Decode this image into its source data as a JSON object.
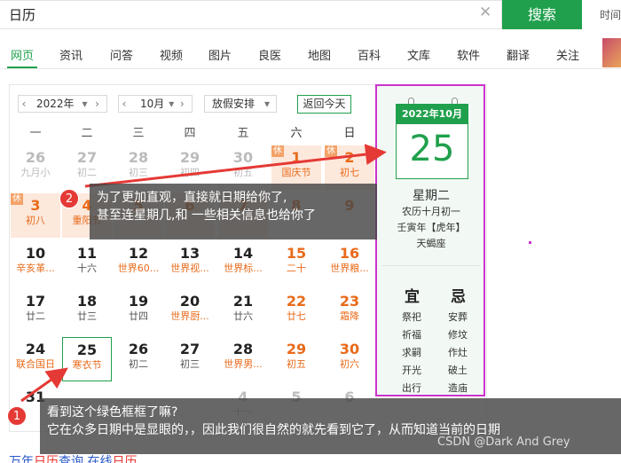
{
  "search": {
    "query": "日历",
    "button": "搜索",
    "time_link": "时间"
  },
  "tabs": [
    "网页",
    "资讯",
    "问答",
    "视频",
    "图片",
    "良医",
    "地图",
    "百科",
    "文库",
    "软件",
    "翻译",
    "关注"
  ],
  "controls": {
    "year": "2022年",
    "month": "10月",
    "holiday": "放假安排",
    "today": "返回今天"
  },
  "weekdays": [
    "一",
    "二",
    "三",
    "四",
    "五",
    "六",
    "日"
  ],
  "rows": [
    [
      {
        "n": "26",
        "l": "九月小",
        "o": true
      },
      {
        "n": "27",
        "l": "初二",
        "o": true
      },
      {
        "n": "28",
        "l": "初三",
        "o": true
      },
      {
        "n": "29",
        "l": "初四",
        "o": true
      },
      {
        "n": "30",
        "l": "初五",
        "o": true
      },
      {
        "n": "1",
        "l": "国庆节",
        "rest": true,
        "b": "休",
        "red": true
      },
      {
        "n": "2",
        "l": "初七",
        "rest": true,
        "b": "休",
        "red": true
      }
    ],
    [
      {
        "n": "3",
        "l": "初八",
        "rest": true,
        "b": "休",
        "red": true
      },
      {
        "n": "4",
        "l": "重阳节",
        "rest": true,
        "b": "休",
        "red": true
      },
      {
        "n": "5",
        "l": "",
        "rest": true,
        "red": true
      },
      {
        "n": "6",
        "l": "",
        "rest": true,
        "red": true
      },
      {
        "n": "7",
        "l": "",
        "rest": true,
        "red": true
      },
      {
        "n": "8",
        "l": "",
        "red": true
      },
      {
        "n": "9",
        "l": "",
        "red": true
      }
    ],
    [
      {
        "n": "10",
        "l": "辛亥革...",
        "lred": true
      },
      {
        "n": "11",
        "l": "十六"
      },
      {
        "n": "12",
        "l": "世界60...",
        "lred": true
      },
      {
        "n": "13",
        "l": "世界视...",
        "lred": true
      },
      {
        "n": "14",
        "l": "世界标...",
        "lred": true
      },
      {
        "n": "15",
        "l": "二十",
        "red": true
      },
      {
        "n": "16",
        "l": "世界粮...",
        "red": true
      }
    ],
    [
      {
        "n": "17",
        "l": "廿二"
      },
      {
        "n": "18",
        "l": "廿三"
      },
      {
        "n": "19",
        "l": "廿四"
      },
      {
        "n": "20",
        "l": "世界厨...",
        "lred": true
      },
      {
        "n": "21",
        "l": "廿六"
      },
      {
        "n": "22",
        "l": "廿七",
        "red": true
      },
      {
        "n": "23",
        "l": "霜降",
        "red": true
      }
    ],
    [
      {
        "n": "24",
        "l": "联合国日",
        "lred": true
      },
      {
        "n": "25",
        "l": "寒衣节",
        "lred": true,
        "sel": true
      },
      {
        "n": "26",
        "l": "初二"
      },
      {
        "n": "27",
        "l": "初三"
      },
      {
        "n": "28",
        "l": "世界男...",
        "lred": true
      },
      {
        "n": "29",
        "l": "初五",
        "red": true
      },
      {
        "n": "30",
        "l": "初六",
        "red": true
      }
    ],
    [
      {
        "n": "31",
        "l": "",
        "o": false
      },
      {
        "n": "",
        "l": ""
      },
      {
        "n": "",
        "l": ""
      },
      {
        "n": "",
        "l": ""
      },
      {
        "n": "4",
        "l": "十一",
        "o": true
      },
      {
        "n": "5",
        "l": "",
        "o": true
      },
      {
        "n": "6",
        "l": "",
        "o": true
      }
    ]
  ],
  "panel": {
    "header": "2022年10月",
    "day": "25",
    "weekday": "星期二",
    "lunar": "农历十月初一",
    "ganzhi": "壬寅年【虎年】",
    "zodiac": "天蝎座",
    "yi_title": "宜",
    "ji_title": "忌",
    "yi": [
      "祭祀",
      "祈福",
      "求嗣",
      "开光",
      "出行"
    ],
    "ji": [
      "安葬",
      "修坟",
      "作灶",
      "破土",
      "造庙"
    ]
  },
  "notes": {
    "n1_num": "1",
    "n1_line1": "看到这个绿色框框了嘛?",
    "n1_line2": "它在众多日期中是显眼的，，因此我们很自然的就先看到它了，从而知道当前的日期",
    "n2_num": "2",
    "n2_line1": "为了更加直观，直接就日期给你了,",
    "n2_line2": "甚至连星期几,和 一些相关信息也给你了"
  },
  "footer": {
    "a": "万年",
    "b": "日历",
    "c": "查询 在线",
    "d": "日历"
  },
  "watermark": "CSDN @Dark And Grey"
}
